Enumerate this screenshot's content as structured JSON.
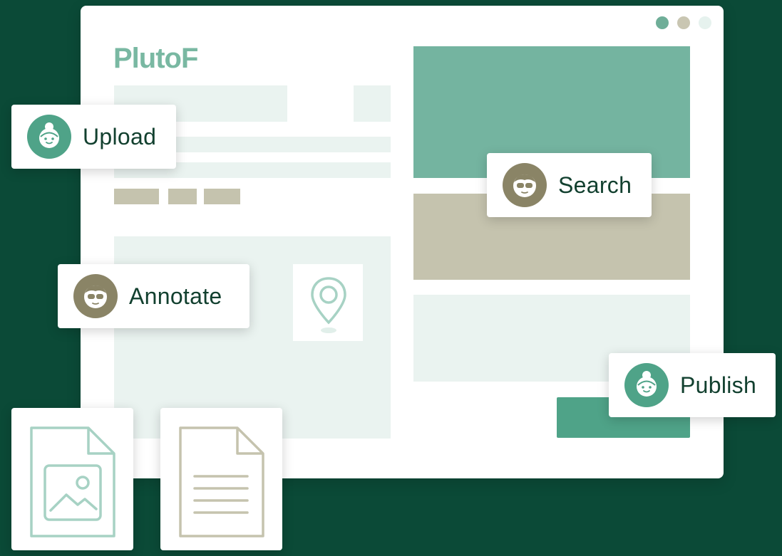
{
  "app": {
    "logo_text": "PlutoF"
  },
  "window": {
    "controls": [
      {
        "name": "window-dot-1",
        "color": "#6fae98"
      },
      {
        "name": "window-dot-2",
        "color": "#c9c6b2"
      },
      {
        "name": "window-dot-3",
        "color": "#e6f2ee"
      }
    ]
  },
  "actions": {
    "upload_label": "Upload",
    "search_label": "Search",
    "annotate_label": "Annotate",
    "publish_label": "Publish"
  },
  "icons": {
    "location_pin": "location-pin-icon",
    "image_file": "image-file-icon",
    "text_file": "text-file-icon",
    "avatar_bun": "avatar-bun-icon",
    "avatar_glasses": "avatar-glasses-icon"
  },
  "colors": {
    "background": "#0b4a37",
    "accent_green": "#4fa388",
    "accent_tan": "#8a8466",
    "placeholder_light": "#eaf3f0",
    "placeholder_tan": "#c5c3ae",
    "placeholder_green": "#74b4a0"
  }
}
